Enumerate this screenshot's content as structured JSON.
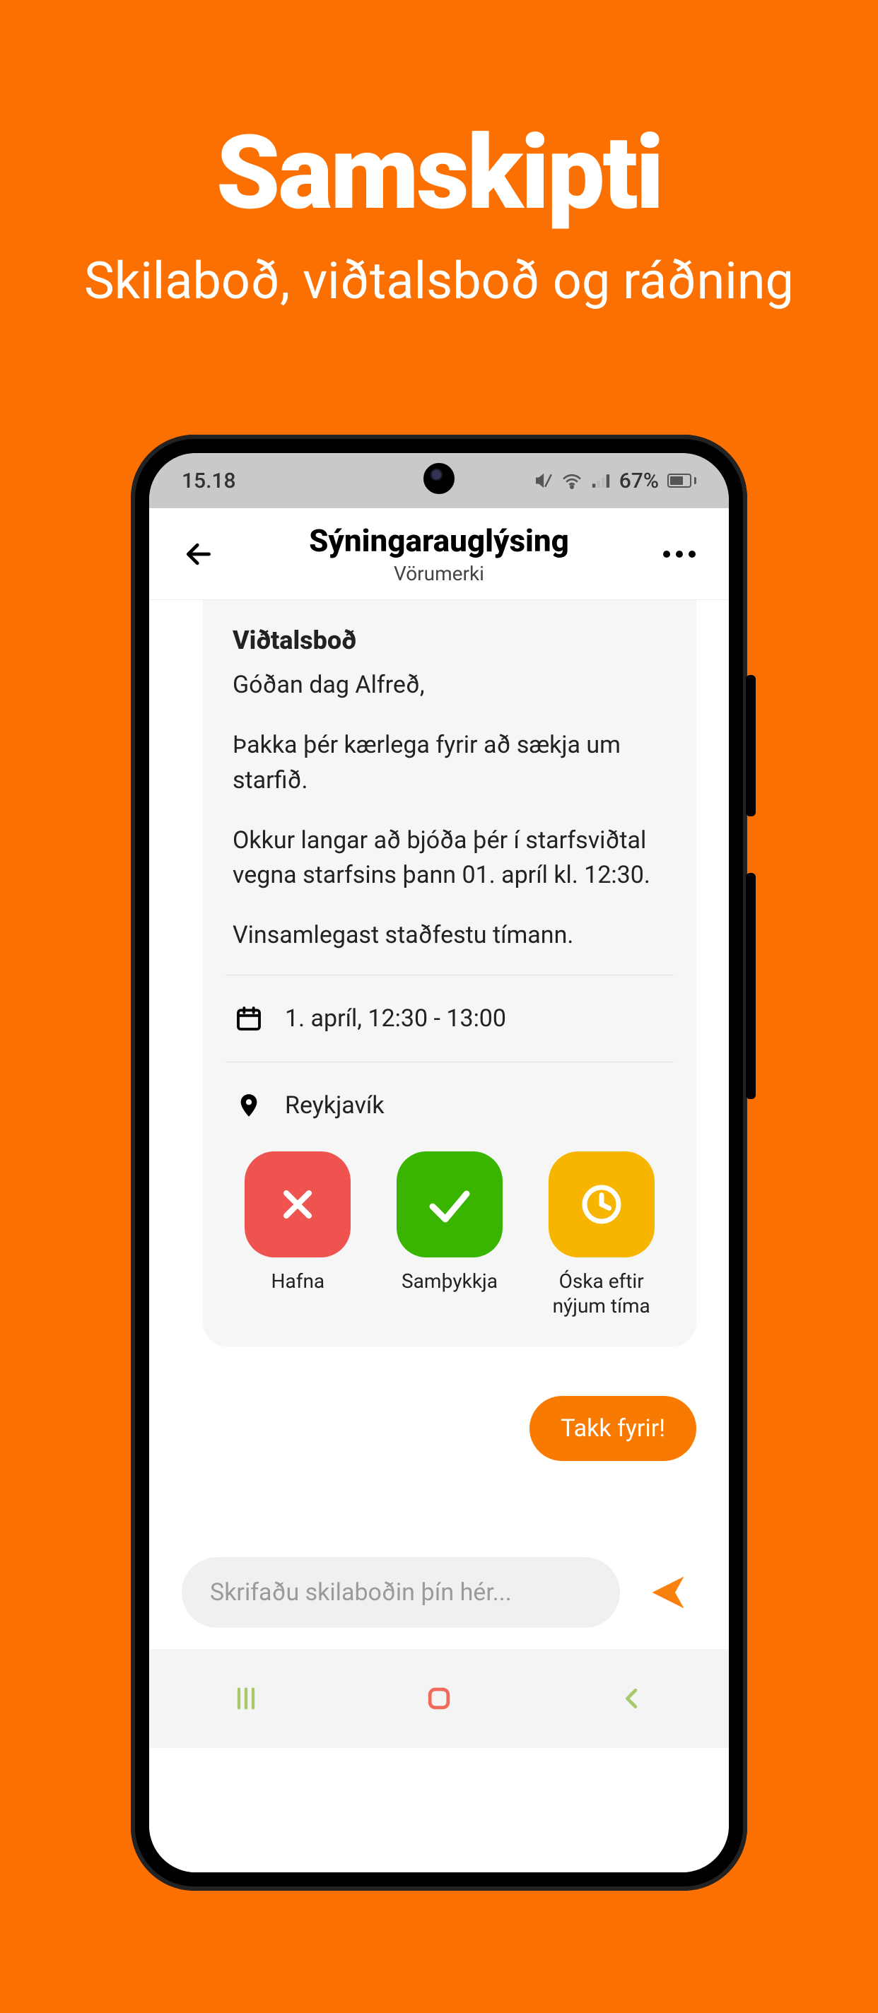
{
  "promo": {
    "title": "Samskipti",
    "subtitle": "Skilaboð, viðtalsboð og ráðning"
  },
  "statusbar": {
    "time": "15.18",
    "battery_text": "67%"
  },
  "header": {
    "title": "Sýningarauglýsing",
    "subtitle": "Vörumerki"
  },
  "message": {
    "title": "Viðtalsboð",
    "paragraphs": [
      "Góðan dag Alfreð,",
      "Þakka þér kærlega fyrir að sækja um starfið.",
      "Okkur langar að bjóða þér í starfsviðtal vegna starfsins þann 01. apríl kl. 12:30.",
      "Vinsamlegast staðfestu tímann."
    ],
    "datetime": "1. apríl, 12:30 - 13:00",
    "location": "Reykjavík"
  },
  "actions": {
    "reject": "Hafna",
    "accept": "Samþykkja",
    "reschedule": "Óska eftir nýjum tíma"
  },
  "reply": {
    "text": "Takk fyrir!"
  },
  "composer": {
    "placeholder": "Skrifaðu skilaboðin þín hér..."
  }
}
